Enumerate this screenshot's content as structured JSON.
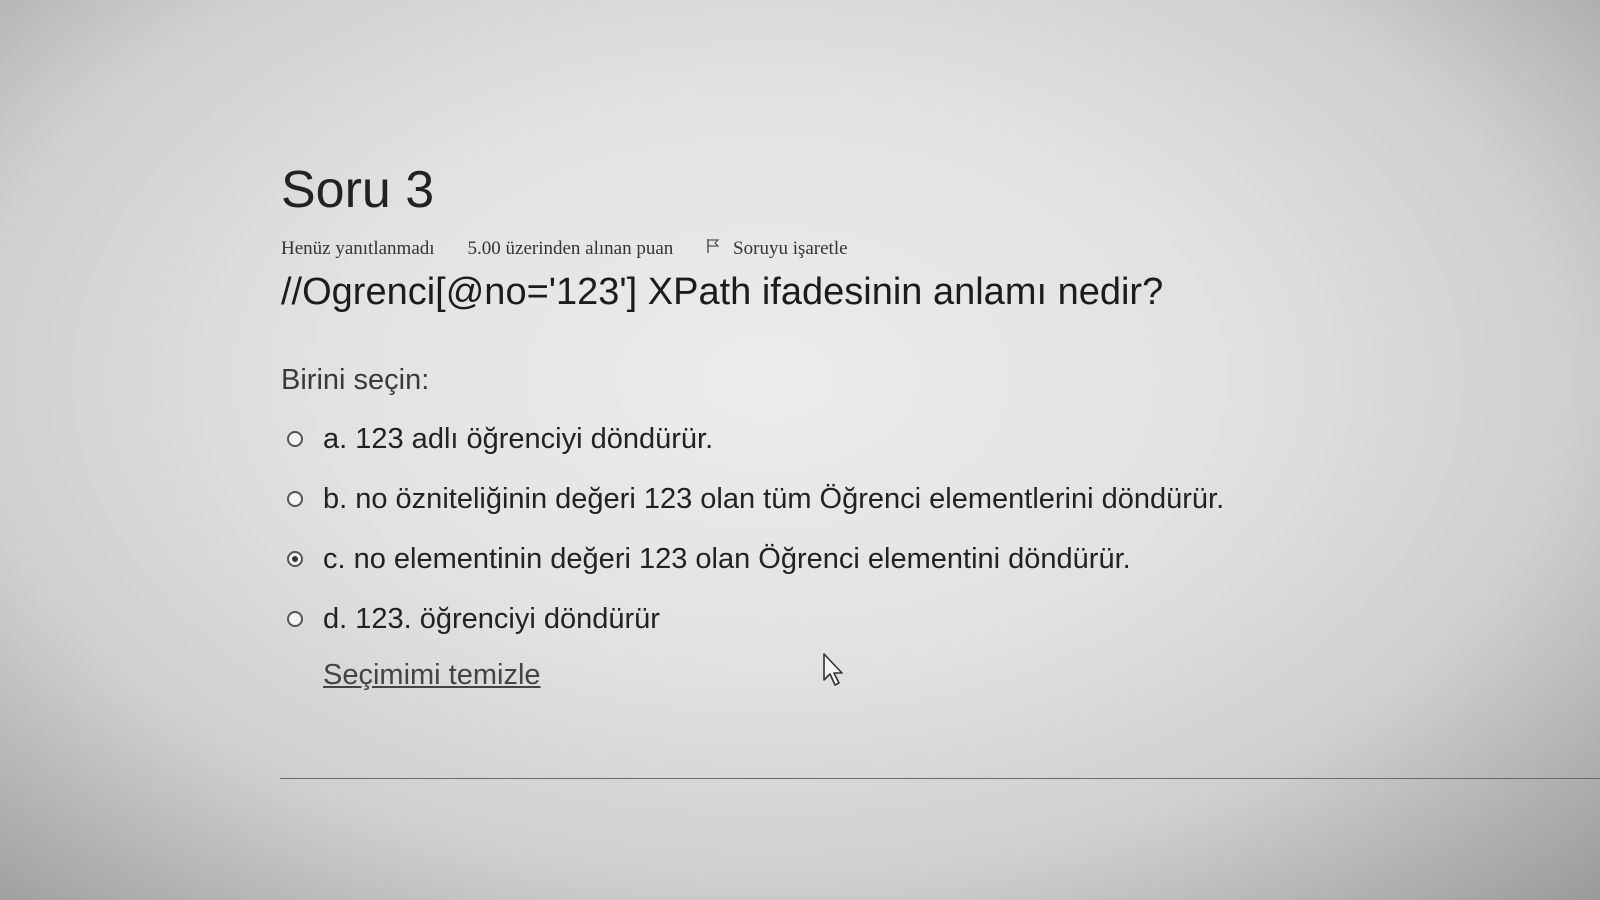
{
  "question": {
    "title": "Soru 3",
    "state": "Henüz yanıtlanmadı",
    "grade": "5.00 üzerinden alınan puan",
    "flag_label": "Soruyu işaretle",
    "text": "//Ogrenci[@no='123'] XPath ifadesinin anlamı nedir?",
    "prompt": "Birini seçin:",
    "answers": [
      {
        "label": "a. 123 adlı öğrenciyi döndürür.",
        "selected": false
      },
      {
        "label": "b. no özniteliğinin değeri 123 olan tüm Öğrenci elementlerini döndürür.",
        "selected": false
      },
      {
        "label": "c. no elementinin değeri 123 olan Öğrenci elementini döndürür.",
        "selected": true
      },
      {
        "label": "d. 123. öğrenciyi döndürür",
        "selected": false
      }
    ],
    "clear_label": "Seçimimi temizle"
  },
  "icons": {
    "flag": "flag-icon",
    "cursor": "mouse-pointer-icon"
  }
}
